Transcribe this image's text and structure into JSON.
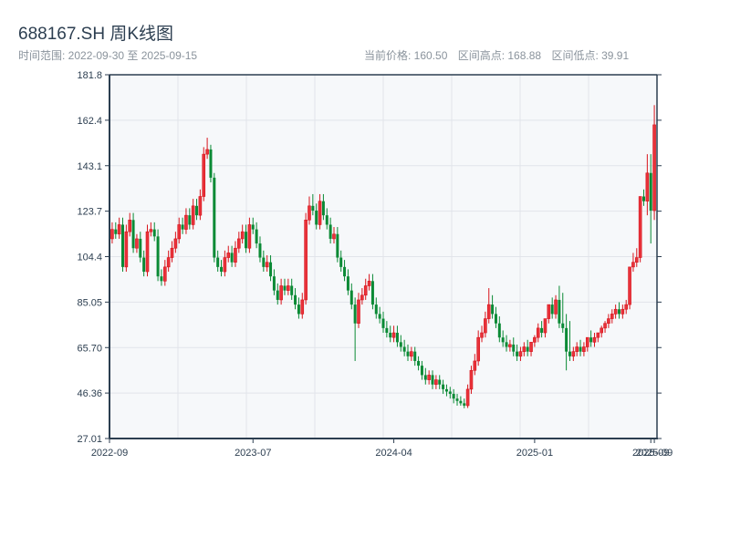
{
  "header": {
    "title": "688167.SH 周K线图",
    "range_label": "时间范围: 2022-09-30 至 2025-09-15",
    "current_price": "当前价格: 160.50",
    "range_high": "区间高点: 168.88",
    "range_low": "区间低点: 39.91"
  },
  "colors": {
    "up": "#d8141c",
    "down": "#0a8a35",
    "plot_bg": "#f6f8fa",
    "grid": "#e1e4ea",
    "axis": "#2c3e50"
  },
  "chart_data": {
    "type": "candlestick",
    "title": "688167.SH 周K线图",
    "xlabel": "",
    "ylabel": "",
    "ylim": [
      27.01,
      181.8
    ],
    "y_ticks": [
      "181.8",
      "162.4",
      "143.1",
      "123.7",
      "104.4",
      "85.05",
      "65.70",
      "46.36",
      "27.01"
    ],
    "x_ticks": [
      {
        "index": 0,
        "label": "2022-09"
      },
      {
        "index": 40,
        "label": "2023-07"
      },
      {
        "index": 80,
        "label": "2024-04"
      },
      {
        "index": 120,
        "label": "2025-01"
      },
      {
        "index": 153,
        "label": "2025-09"
      },
      {
        "index": 154,
        "label": "2025-09"
      }
    ],
    "grid": true,
    "up_color_meaning": "red = up, green = down",
    "open": [
      112,
      116,
      114,
      118,
      100,
      115,
      120,
      108,
      112,
      104,
      98,
      115,
      116,
      113,
      96,
      94,
      100,
      104,
      108,
      112,
      118,
      116,
      122,
      118,
      126,
      122,
      130,
      148,
      150,
      138,
      104,
      100,
      98,
      104,
      106,
      102,
      108,
      112,
      115,
      108,
      118,
      116,
      110,
      104,
      100,
      102,
      96,
      90,
      86,
      92,
      90,
      92,
      88,
      84,
      80,
      86,
      120,
      126,
      124,
      118,
      128,
      122,
      118,
      112,
      114,
      104,
      100,
      96,
      90,
      84,
      76,
      86,
      88,
      92,
      94,
      84,
      80,
      78,
      74,
      72,
      70,
      72,
      68,
      66,
      64,
      62,
      64,
      60,
      58,
      54,
      52,
      54,
      50,
      52,
      50,
      48,
      47,
      46,
      44,
      43,
      42,
      41,
      48,
      56,
      60,
      70,
      72,
      78,
      84,
      80,
      76,
      70,
      68,
      66,
      67,
      64,
      62,
      64,
      66,
      64,
      68,
      70,
      74,
      72,
      78,
      84,
      80,
      86,
      76,
      74,
      64,
      62,
      64,
      66,
      64,
      66,
      70,
      68,
      70,
      72,
      74,
      76,
      78,
      80,
      82,
      80,
      82,
      84,
      100,
      102,
      104,
      130,
      128,
      140,
      124
    ],
    "high": [
      119,
      119,
      121,
      121,
      118,
      123,
      123,
      114,
      115,
      107,
      118,
      119,
      119,
      116,
      99,
      103,
      107,
      111,
      115,
      121,
      121,
      125,
      125,
      129,
      129,
      133,
      151,
      155,
      152,
      140,
      107,
      103,
      107,
      109,
      109,
      111,
      115,
      118,
      118,
      121,
      121,
      119,
      113,
      107,
      105,
      105,
      99,
      93,
      95,
      95,
      95,
      95,
      91,
      87,
      89,
      123,
      130,
      131,
      127,
      131,
      131,
      125,
      121,
      117,
      117,
      107,
      103,
      99,
      93,
      87,
      89,
      91,
      95,
      97,
      97,
      87,
      83,
      81,
      77,
      75,
      75,
      75,
      71,
      69,
      67,
      66,
      66,
      62,
      60,
      57,
      56,
      56,
      54,
      54,
      52,
      50,
      49,
      48,
      46,
      45,
      44,
      50,
      58,
      63,
      73,
      75,
      81,
      91,
      88,
      83,
      79,
      73,
      71,
      69,
      70,
      67,
      66,
      68,
      69,
      67,
      71,
      76,
      77,
      76,
      81,
      87,
      88,
      92,
      89,
      80,
      77,
      66,
      68,
      69,
      68,
      70,
      73,
      72,
      72,
      75,
      77,
      80,
      82,
      84,
      85,
      84,
      86,
      88,
      106,
      108,
      107,
      133,
      148,
      148,
      168.88
    ],
    "low": [
      110,
      112,
      112,
      98,
      98,
      113,
      106,
      106,
      102,
      96,
      96,
      113,
      111,
      94,
      92,
      92,
      98,
      102,
      106,
      110,
      114,
      114,
      116,
      116,
      120,
      120,
      128,
      146,
      136,
      102,
      98,
      96,
      96,
      102,
      100,
      100,
      106,
      110,
      106,
      106,
      114,
      108,
      102,
      98,
      98,
      94,
      88,
      84,
      84,
      88,
      88,
      86,
      82,
      78,
      78,
      84,
      118,
      122,
      116,
      116,
      120,
      116,
      110,
      110,
      102,
      98,
      94,
      88,
      82,
      60,
      74,
      84,
      86,
      90,
      82,
      78,
      76,
      72,
      70,
      68,
      68,
      66,
      64,
      62,
      60,
      60,
      58,
      56,
      52,
      50,
      50,
      48,
      48,
      48,
      46,
      45,
      44,
      42,
      41,
      41,
      39.91,
      40,
      46,
      54,
      58,
      68,
      70,
      76,
      78,
      74,
      68,
      66,
      64,
      64,
      62,
      60,
      60,
      62,
      62,
      62,
      66,
      68,
      70,
      70,
      76,
      78,
      78,
      74,
      72,
      56,
      60,
      60,
      62,
      62,
      62,
      64,
      66,
      66,
      68,
      70,
      72,
      74,
      76,
      78,
      78,
      78,
      80,
      82,
      98,
      100,
      102,
      126,
      122,
      110,
      120
    ],
    "close": [
      116,
      114,
      118,
      100,
      115,
      120,
      108,
      112,
      104,
      98,
      115,
      116,
      113,
      96,
      94,
      100,
      104,
      108,
      112,
      118,
      116,
      122,
      118,
      126,
      122,
      130,
      148,
      150,
      138,
      104,
      100,
      98,
      104,
      106,
      102,
      108,
      112,
      115,
      108,
      118,
      116,
      110,
      104,
      100,
      102,
      96,
      90,
      86,
      92,
      90,
      92,
      88,
      84,
      80,
      86,
      120,
      126,
      124,
      118,
      128,
      122,
      118,
      112,
      114,
      104,
      100,
      96,
      90,
      84,
      76,
      86,
      88,
      92,
      94,
      84,
      80,
      78,
      74,
      72,
      70,
      72,
      68,
      66,
      64,
      62,
      64,
      60,
      58,
      54,
      52,
      54,
      50,
      52,
      50,
      48,
      47,
      46,
      44,
      43,
      42,
      41,
      48,
      56,
      60,
      70,
      72,
      78,
      84,
      80,
      76,
      70,
      68,
      66,
      67,
      64,
      62,
      64,
      66,
      64,
      68,
      70,
      74,
      72,
      78,
      84,
      80,
      86,
      76,
      74,
      64,
      62,
      64,
      66,
      64,
      66,
      70,
      68,
      70,
      72,
      74,
      76,
      78,
      80,
      82,
      80,
      82,
      84,
      100,
      102,
      104,
      130,
      128,
      140,
      124,
      160.5
    ]
  }
}
